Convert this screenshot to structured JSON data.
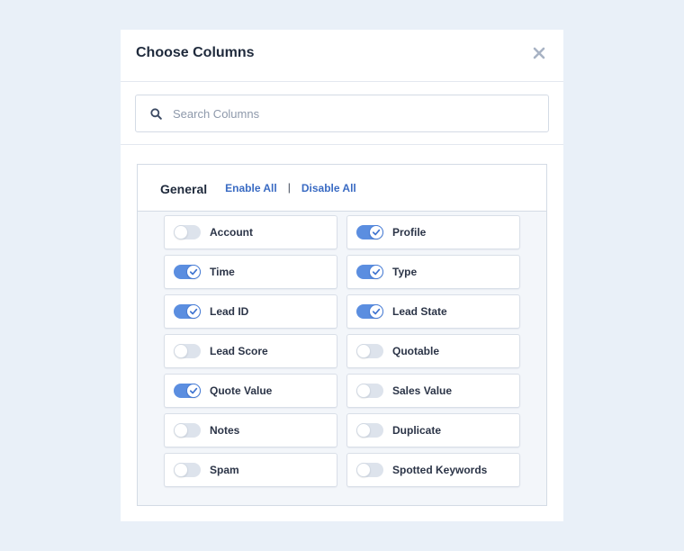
{
  "modal": {
    "title": "Choose Columns",
    "close_icon": "close-icon"
  },
  "search": {
    "placeholder": "Search Columns",
    "value": "",
    "icon": "search-icon"
  },
  "group": {
    "title": "General",
    "enable_all": "Enable All",
    "separator": "|",
    "disable_all": "Disable All",
    "items": [
      {
        "label": "Account",
        "enabled": false
      },
      {
        "label": "Profile",
        "enabled": true
      },
      {
        "label": "Time",
        "enabled": true
      },
      {
        "label": "Type",
        "enabled": true
      },
      {
        "label": "Lead ID",
        "enabled": true
      },
      {
        "label": "Lead State",
        "enabled": true
      },
      {
        "label": "Lead Score",
        "enabled": false
      },
      {
        "label": "Quotable",
        "enabled": false
      },
      {
        "label": "Quote Value",
        "enabled": true
      },
      {
        "label": "Sales Value",
        "enabled": false
      },
      {
        "label": "Notes",
        "enabled": false
      },
      {
        "label": "Duplicate",
        "enabled": false
      },
      {
        "label": "Spam",
        "enabled": false
      },
      {
        "label": "Spotted Keywords",
        "enabled": false
      }
    ]
  },
  "colors": {
    "accent": "#5b8ee0",
    "link": "#3a6bc3",
    "background": "#e9f0f8"
  }
}
